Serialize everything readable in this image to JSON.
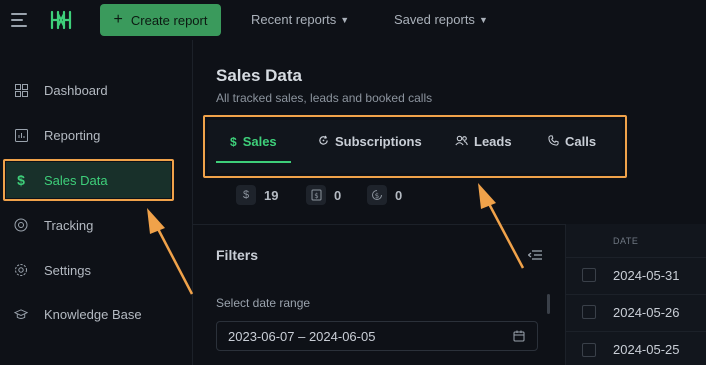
{
  "topbar": {
    "create_label": "Create report",
    "recent_label": "Recent reports",
    "saved_label": "Saved reports"
  },
  "sidebar": {
    "items": [
      {
        "label": "Dashboard",
        "icon": "grid-icon"
      },
      {
        "label": "Reporting",
        "icon": "bar-chart-icon"
      },
      {
        "label": "Sales Data",
        "icon": "dollar-icon",
        "active": true
      },
      {
        "label": "Tracking",
        "icon": "target-icon"
      },
      {
        "label": "Settings",
        "icon": "gear-icon"
      },
      {
        "label": "Knowledge Base",
        "icon": "graduation-cap-icon"
      }
    ]
  },
  "main": {
    "title": "Sales Data",
    "subtitle": "All tracked sales, leads and booked calls",
    "tabs": [
      {
        "label": "Sales",
        "icon": "dollar-icon",
        "active": true
      },
      {
        "label": "Subscriptions",
        "icon": "refresh-icon"
      },
      {
        "label": "Leads",
        "icon": "users-icon"
      },
      {
        "label": "Calls",
        "icon": "phone-icon"
      }
    ],
    "stats": [
      {
        "value": "19",
        "icon": "dollar-icon"
      },
      {
        "value": "0",
        "icon": "receipt-icon"
      },
      {
        "value": "0",
        "icon": "refund-icon"
      }
    ]
  },
  "filters": {
    "title": "Filters",
    "date_label": "Select date range",
    "date_value": "2023-06-07 – 2024-06-05"
  },
  "table": {
    "header": "DATE",
    "rows": [
      "2024-05-31",
      "2024-05-26",
      "2024-05-25"
    ]
  },
  "colors": {
    "accent": "#3ecf7a",
    "button": "#3a9a5c",
    "highlight": "#f0a24a",
    "background": "#0e1117"
  }
}
